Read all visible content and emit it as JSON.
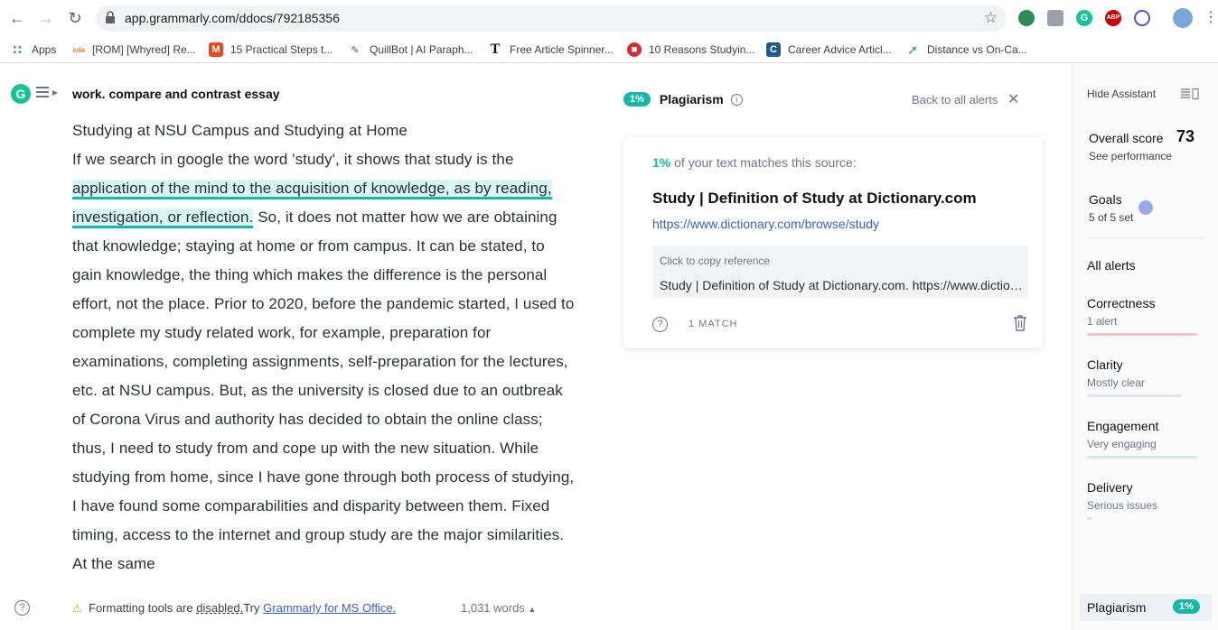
{
  "browser": {
    "url": "app.grammarly.com/ddocs/792185356",
    "bookmarks": [
      {
        "label": "Apps",
        "icon": "apps-grid-icon"
      },
      {
        "label": "[ROM] [Whyred] Re...",
        "icon": "xda-icon"
      },
      {
        "label": "15 Practical Steps t...",
        "icon": "m-icon"
      },
      {
        "label": "QuillBot | AI Paraph...",
        "icon": "quill-icon"
      },
      {
        "label": "Free Article Spinner...",
        "icon": "t-icon"
      },
      {
        "label": "10 Reasons Studyin...",
        "icon": "shield-icon"
      },
      {
        "label": "Career Advice Articl...",
        "icon": "c-icon"
      },
      {
        "label": "Distance vs On-Ca...",
        "icon": "leaf-icon"
      }
    ]
  },
  "editor": {
    "doc_title": "work. compare and contrast essay",
    "heading": "Studying at NSU Campus and Studying at Home",
    "para_start": "If we search in google the word 'study', it shows that study is the ",
    "highlighted": "application of the mind to the acquisition of knowledge, as by reading, investigation, or reflection.",
    "para_rest": " So, it does not matter how we are obtaining that knowledge; staying at home or from campus. It can be stated, to gain knowledge, the thing which makes the difference is the personal effort, not the place. Prior to 2020, before the pandemic started, I used to complete my study related work, for example, preparation for examinations, completing assignments, self-preparation for the lectures, etc. at NSU campus. But, as the university is closed due to an outbreak of Corona Virus and authority has decided to obtain the online class; thus, I need to study from and cope up with the new situation. While studying from home, since I have gone through both process of studying, I have found some comparabilities and disparity between them. Fixed timing, access to the internet and group study are the major similarities. At the same",
    "footer": {
      "fmt_prefix": "Formatting tools are ",
      "fmt_disabled": "disabled.",
      "fmt_try": "Try ",
      "fmt_link": "Grammarly for MS Office.",
      "word_count": "1,031 words"
    }
  },
  "plagiarism": {
    "percent": "1%",
    "title": "Plagiarism",
    "back_link": "Back to all alerts",
    "match_pct": "1%",
    "match_text": " of your text matches this source:",
    "source_title": "Study | Definition of Study at Dictionary.com",
    "source_url": "https://www.dictionary.com/browse/study",
    "ref_label": "Click to copy reference",
    "ref_text": "Study | Definition of Study at Dictionary.com. https://www.dictionary.com/browse/study",
    "match_count": "1 MATCH"
  },
  "sidebar": {
    "hide_assistant": "Hide Assistant",
    "overall_label": "Overall score",
    "overall_score": "73",
    "see_performance": "See performance",
    "goals_label": "Goals",
    "goals_sub": "5 of 5 set",
    "all_alerts": "All alerts",
    "categories": [
      {
        "name": "Correctness",
        "sub": "1 alert",
        "color": "#f4c3cc"
      },
      {
        "name": "Clarity",
        "sub": "Mostly clear",
        "color": "#dfe5f5"
      },
      {
        "name": "Engagement",
        "sub": "Very engaging",
        "color": "#c7ecdf"
      },
      {
        "name": "Delivery",
        "sub": "Serious issues",
        "color": "#e4e4e4"
      }
    ],
    "plagiarism_tab": "Plagiarism",
    "plagiarism_pct": "1%"
  },
  "colors": {
    "accent": "#15c39a",
    "link": "#3b5fc0",
    "highlight": "#d8f7f4"
  }
}
